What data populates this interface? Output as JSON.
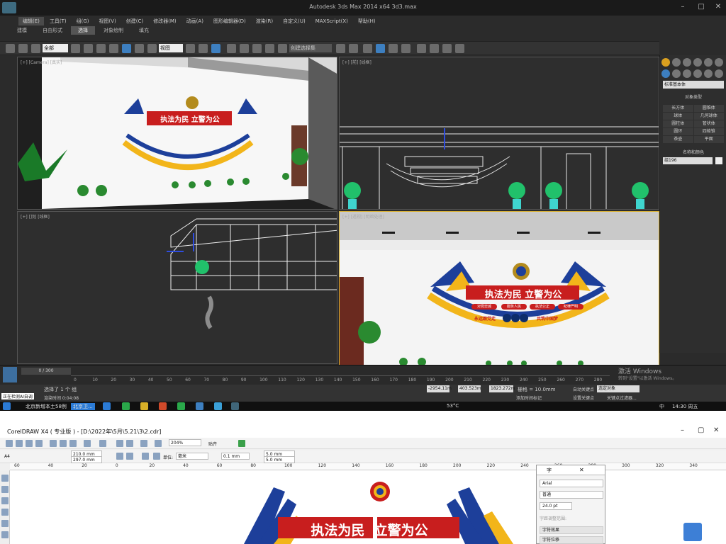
{
  "max": {
    "title": "Autodesk 3ds Max  2014 x64        3d3.max",
    "menus": [
      "编辑(E)",
      "工具(T)",
      "组(G)",
      "视图(V)",
      "创建(C)",
      "修改器(M)",
      "动画(A)",
      "图形编辑器(D)",
      "渲染(R)",
      "自定义(U)",
      "MAXScript(X)",
      "帮助(H)"
    ],
    "ribbon_tabs": [
      "建模",
      "自由形式",
      "选择",
      "对象绘制",
      "填充"
    ],
    "toolbar": {
      "selection_filter": "全部",
      "view_mode": "视图",
      "named_selection": "创建选择集"
    },
    "viewports": {
      "perspective_label": "[+] [Camera] [真实]",
      "front_label": "[+] [前] [线框]",
      "top_label": "[+] [顶] [线框]",
      "camera_label": "[+] [透视] [明暗处理]"
    },
    "scene": {
      "slogan": "执法为民  立警为公",
      "tags": [
        "对党忠诚",
        "服务人民",
        "执法公正",
        "纪律严明"
      ],
      "sub_left": "永远跟党走",
      "sub_right": "共筑中国梦"
    },
    "command_panel": {
      "dropdown": "标准基本体",
      "object_type": "对象类型",
      "primitives": [
        "长方体",
        "圆锥体",
        "球体",
        "几何球体",
        "圆柱体",
        "管状体",
        "圆环",
        "四棱锥",
        "茶壶",
        "平面"
      ],
      "name_color": "名称和颜色",
      "object_name": "组196"
    },
    "timeline": {
      "frame": "0 / 300",
      "ticks": [
        "0",
        "10",
        "20",
        "30",
        "40",
        "50",
        "60",
        "70",
        "80",
        "90",
        "100",
        "110",
        "120",
        "130",
        "140",
        "150",
        "160",
        "170",
        "180",
        "190",
        "200",
        "210",
        "220",
        "230",
        "240",
        "250",
        "260",
        "270",
        "280"
      ]
    },
    "status": {
      "selected": "选择了 1 个 组",
      "render_time": "渲染时间 0:04:08",
      "x": "-2954.11m",
      "y": "403.523m",
      "z": "1823.272m",
      "grid": "栅格 = 10.0mm",
      "auto_key": "自动关键点",
      "set_key": "设置关键点",
      "key_mode": "选定对象",
      "key_filters": "关键点过滤器...",
      "add_time_tag": "添加时间标记",
      "activate_1": "激活 Windows",
      "activate_2": "转到\"设置\"以激活 Windows。",
      "left_btn": "正在检测AI自调"
    },
    "taskbar": {
      "left_text": "北京新增本土58例",
      "app_label": "北京卫...",
      "temp": "53°C",
      "time": "14:30 周五",
      "lang": "中"
    }
  },
  "corel": {
    "title": "CorelDRAW X4 ( 专业版 ) - [D:\\2022年\\5月\\5.21\\3\\2.cdr]",
    "zoom": "204%",
    "snap": "贴齐",
    "paper": "A4",
    "width": "210.0 mm",
    "height": "297.0 mm",
    "unit_label": "单位:",
    "unit": "毫米",
    "nudge": "0.1 mm",
    "dup_x": "5.0 mm",
    "dup_y": "5.0 mm",
    "ruler": [
      "60",
      "40",
      "20",
      "0",
      "20",
      "40",
      "60",
      "80",
      "100",
      "120",
      "140",
      "160",
      "180",
      "200",
      "220",
      "240",
      "260",
      "280",
      "300",
      "320",
      "340"
    ],
    "docker": {
      "title": "字",
      "font": "Arial",
      "style": "普通",
      "size": "24.0 pt",
      "range": "字距调整范围:",
      "effects": "字符效果",
      "displacement": "字符位移"
    },
    "design": {
      "slogan": "执法为民  立警为公"
    }
  }
}
